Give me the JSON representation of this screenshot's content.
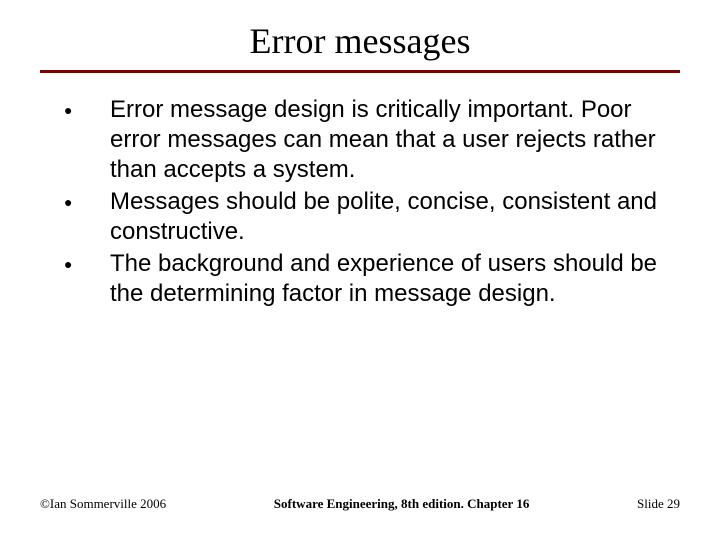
{
  "title": "Error messages",
  "bullets": [
    "Error message design is critically important. Poor error messages can mean that a user rejects rather than accepts a system.",
    "Messages should be polite, concise, consistent and constructive.",
    "The background and experience of users should be the determining factor in message design."
  ],
  "footer": {
    "left": "©Ian Sommerville 2006",
    "center": "Software Engineering, 8th edition. Chapter 16",
    "right": "Slide 29"
  }
}
